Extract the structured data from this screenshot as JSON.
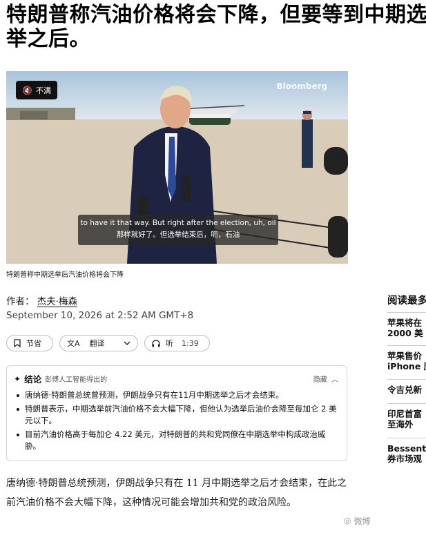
{
  "article": {
    "headline": "特朗普称汽油价格将会下降，但要等到中期选举之后。",
    "video": {
      "mute_label": "不满",
      "brand": "Bloomberg",
      "subtitle_en": "to have it that way. But right after the election, uh, oil",
      "subtitle_zh": "那样就好了。但选举结束后，呃，石油"
    },
    "caption": "特朗普称中期选举后汽油价格将会下降",
    "author_prefix": "作者：",
    "author_name": "杰夫·梅森",
    "date": "September 10, 2026 at 2:52 AM GMT+8",
    "actions": {
      "bookmark": "节省",
      "translate": "翻译",
      "listen": "听",
      "listen_duration": "1:39"
    },
    "summary": {
      "title": "结论",
      "subtitle": "彭博人工智能得出的",
      "toggle": "隐藏",
      "points": [
        "唐纳德·特朗普总统曾预测，伊朗战争只有在11月中期选举之后才会结束。",
        "特朗普表示，中期选举前汽油价格不会大幅下降，但他认为选举后油价会降至每加仑 2 美元以下。",
        "目前汽油价格高于每加仑 4.22 美元，对特朗普的共和党同僚在中期选举中构成政治威胁。"
      ]
    },
    "body": "唐纳德·特朗普总统预测，伊朗战争只有在 11 月中期选举之后才会结束，在此之前汽油价格不会大幅下降，这种情况可能会增加共和党的政治风险。"
  },
  "sidebar": {
    "title": "阅读最多",
    "items": [
      {
        "line1": "苹果将在",
        "line2": "2000 美"
      },
      {
        "line1": "苹果售价",
        "line2": "iPhone 历"
      },
      {
        "line1": "令吉兑新",
        "line2": ""
      },
      {
        "line1": "印尼首富",
        "line2": "至海外"
      },
      {
        "line1": "Bessent",
        "line2": "券市场观"
      }
    ]
  },
  "watermark": "微博"
}
